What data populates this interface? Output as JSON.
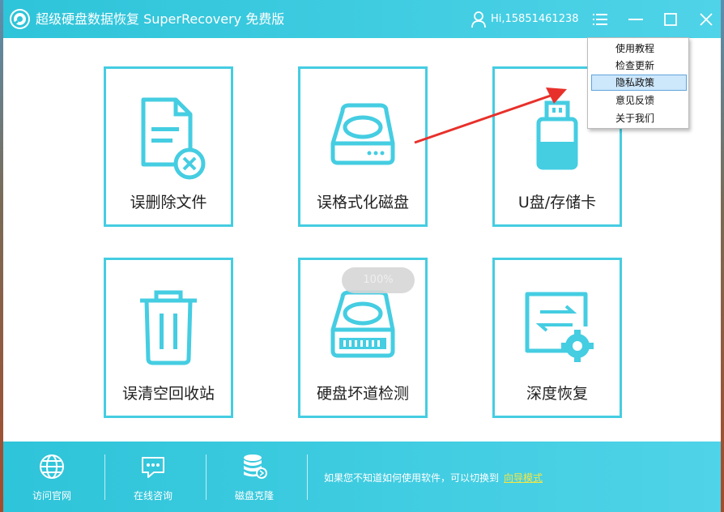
{
  "app": {
    "title": "超级硬盘数据恢复 SuperRecovery 免费版",
    "user_greeting": "Hi,15851461238",
    "accent_color": "#45cde2"
  },
  "titlebar_controls": {
    "menu_icon": "hamburger-list-icon",
    "minimize_icon": "minimize-icon",
    "maximize_icon": "maximize-icon",
    "close_icon": "close-icon"
  },
  "tiles": [
    {
      "label": "误删除文件",
      "icon": "deleted-file-icon"
    },
    {
      "label": "误格式化磁盘",
      "icon": "hard-drive-icon"
    },
    {
      "label": "U盘/存储卡",
      "icon": "usb-drive-icon"
    },
    {
      "label": "误清空回收站",
      "icon": "trash-bin-icon"
    },
    {
      "label": "硬盘坏道检测",
      "icon": "disk-check-icon"
    },
    {
      "label": "深度恢复",
      "icon": "deep-recovery-icon"
    }
  ],
  "progress_badge": "100%",
  "dropdown_menu": {
    "items": [
      {
        "label": "使用教程"
      },
      {
        "label": "检查更新"
      },
      {
        "label": "隐私政策",
        "selected": true
      },
      {
        "label": "意见反馈"
      },
      {
        "label": "关于我们"
      }
    ]
  },
  "footer": {
    "items": [
      {
        "label": "访问官网",
        "icon": "globe-icon"
      },
      {
        "label": "在线咨询",
        "icon": "chat-icon"
      },
      {
        "label": "磁盘克隆",
        "icon": "disk-clone-icon"
      }
    ],
    "hint_text": "如果您不知道如何使用软件，可以切换到",
    "hint_link": "向导模式"
  }
}
